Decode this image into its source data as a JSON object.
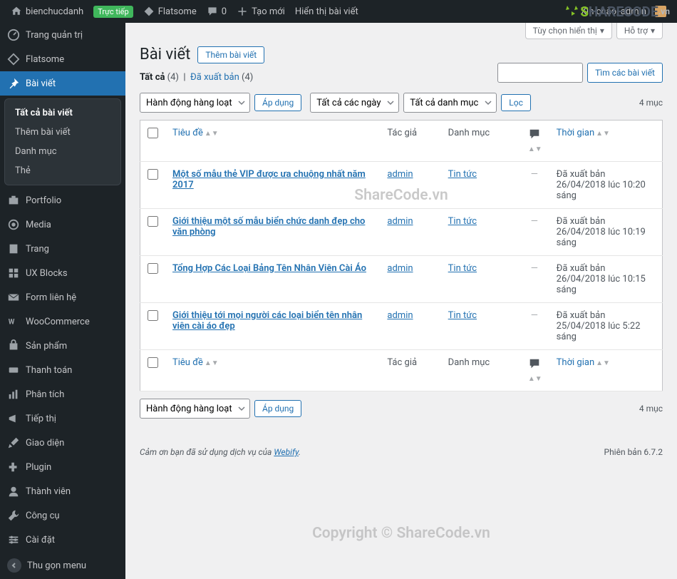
{
  "topbar": {
    "site_name": "bienchucdanh",
    "live_label": "Trực tiếp",
    "flatsome": "Flatsome",
    "comments": "0",
    "tao_moi": "Tạo mới",
    "view_post": "Hiển thị bài viết",
    "greeting": "Xin chào, admin"
  },
  "sidebar": {
    "items": [
      {
        "label": "Trang quản trị",
        "icon": "dashboard"
      },
      {
        "label": "Flatsome",
        "icon": "flatsome"
      },
      {
        "label": "Bài viết",
        "icon": "pin"
      },
      {
        "label": "Portfolio",
        "icon": "briefcase"
      },
      {
        "label": "Media",
        "icon": "media"
      },
      {
        "label": "Trang",
        "icon": "page"
      },
      {
        "label": "UX Blocks",
        "icon": "blocks"
      },
      {
        "label": "Form liên hệ",
        "icon": "mail"
      },
      {
        "label": "WooCommerce",
        "icon": "woo"
      },
      {
        "label": "Sản phẩm",
        "icon": "product"
      },
      {
        "label": "Thanh toán",
        "icon": "cart"
      },
      {
        "label": "Phân tích",
        "icon": "chart"
      },
      {
        "label": "Tiếp thị",
        "icon": "megaphone"
      },
      {
        "label": "Giao diện",
        "icon": "brush"
      },
      {
        "label": "Plugin",
        "icon": "plugin"
      },
      {
        "label": "Thành viên",
        "icon": "user"
      },
      {
        "label": "Công cụ",
        "icon": "tool"
      },
      {
        "label": "Cài đặt",
        "icon": "settings"
      }
    ],
    "submenu": [
      "Tất cả bài viết",
      "Thêm bài viết",
      "Danh mục",
      "Thẻ"
    ],
    "collapse": "Thu gọn menu"
  },
  "screen_opts": {
    "display": "Tùy chọn hiển thị",
    "help": "Hỗ trợ"
  },
  "heading": "Bài viết",
  "add_new": "Thêm bài viết",
  "subsub": {
    "all": "Tất cả",
    "all_count": "(4)",
    "sep": "|",
    "published": "Đã xuất bản",
    "published_count": "(4)"
  },
  "search_btn": "Tìm các bài viết",
  "bulk_select": "Hành động hàng loạt",
  "apply": "Áp dụng",
  "date_filter": "Tất cả các ngày",
  "cat_filter": "Tất cả danh mục",
  "filter": "Lọc",
  "count": "4 mục",
  "cols": {
    "title": "Tiêu đề",
    "author": "Tác giả",
    "cat": "Danh mục",
    "date": "Thời gian"
  },
  "rows": [
    {
      "title": "Một số mẫu thẻ VIP được ưa chuộng nhất năm 2017",
      "author": "admin",
      "cat": "Tin tức",
      "status": "Đã xuất bản",
      "date": "26/04/2018 lúc 10:20 sáng"
    },
    {
      "title": "Giới thiệu một số mẫu biển chức danh đẹp cho văn phòng",
      "author": "admin",
      "cat": "Tin tức",
      "status": "Đã xuất bản",
      "date": "26/04/2018 lúc 10:19 sáng"
    },
    {
      "title": "Tổng Hợp Các Loại Bảng Tên Nhân Viên Cài Áo",
      "author": "admin",
      "cat": "Tin tức",
      "status": "Đã xuất bản",
      "date": "26/04/2018 lúc 10:15 sáng"
    },
    {
      "title": "Giới thiệu tới mọi người các loại biển tên nhân viên cài áo đẹp",
      "author": "admin",
      "cat": "Tin tức",
      "status": "Đã xuất bản",
      "date": "25/04/2018 lúc 5:22 sáng"
    }
  ],
  "footer": {
    "thanks_pre": "Cảm ơn bạn đã sử dụng dịch vụ của ",
    "webify": "Webify",
    "period": ".",
    "version": "Phiên bản 6.7.2"
  },
  "watermark": {
    "brand_s": "S",
    "brand_rest": "HARECODE",
    "vn": ".vn",
    "center": "ShareCode.vn",
    "bottom": "Copyright © ShareCode.vn"
  }
}
